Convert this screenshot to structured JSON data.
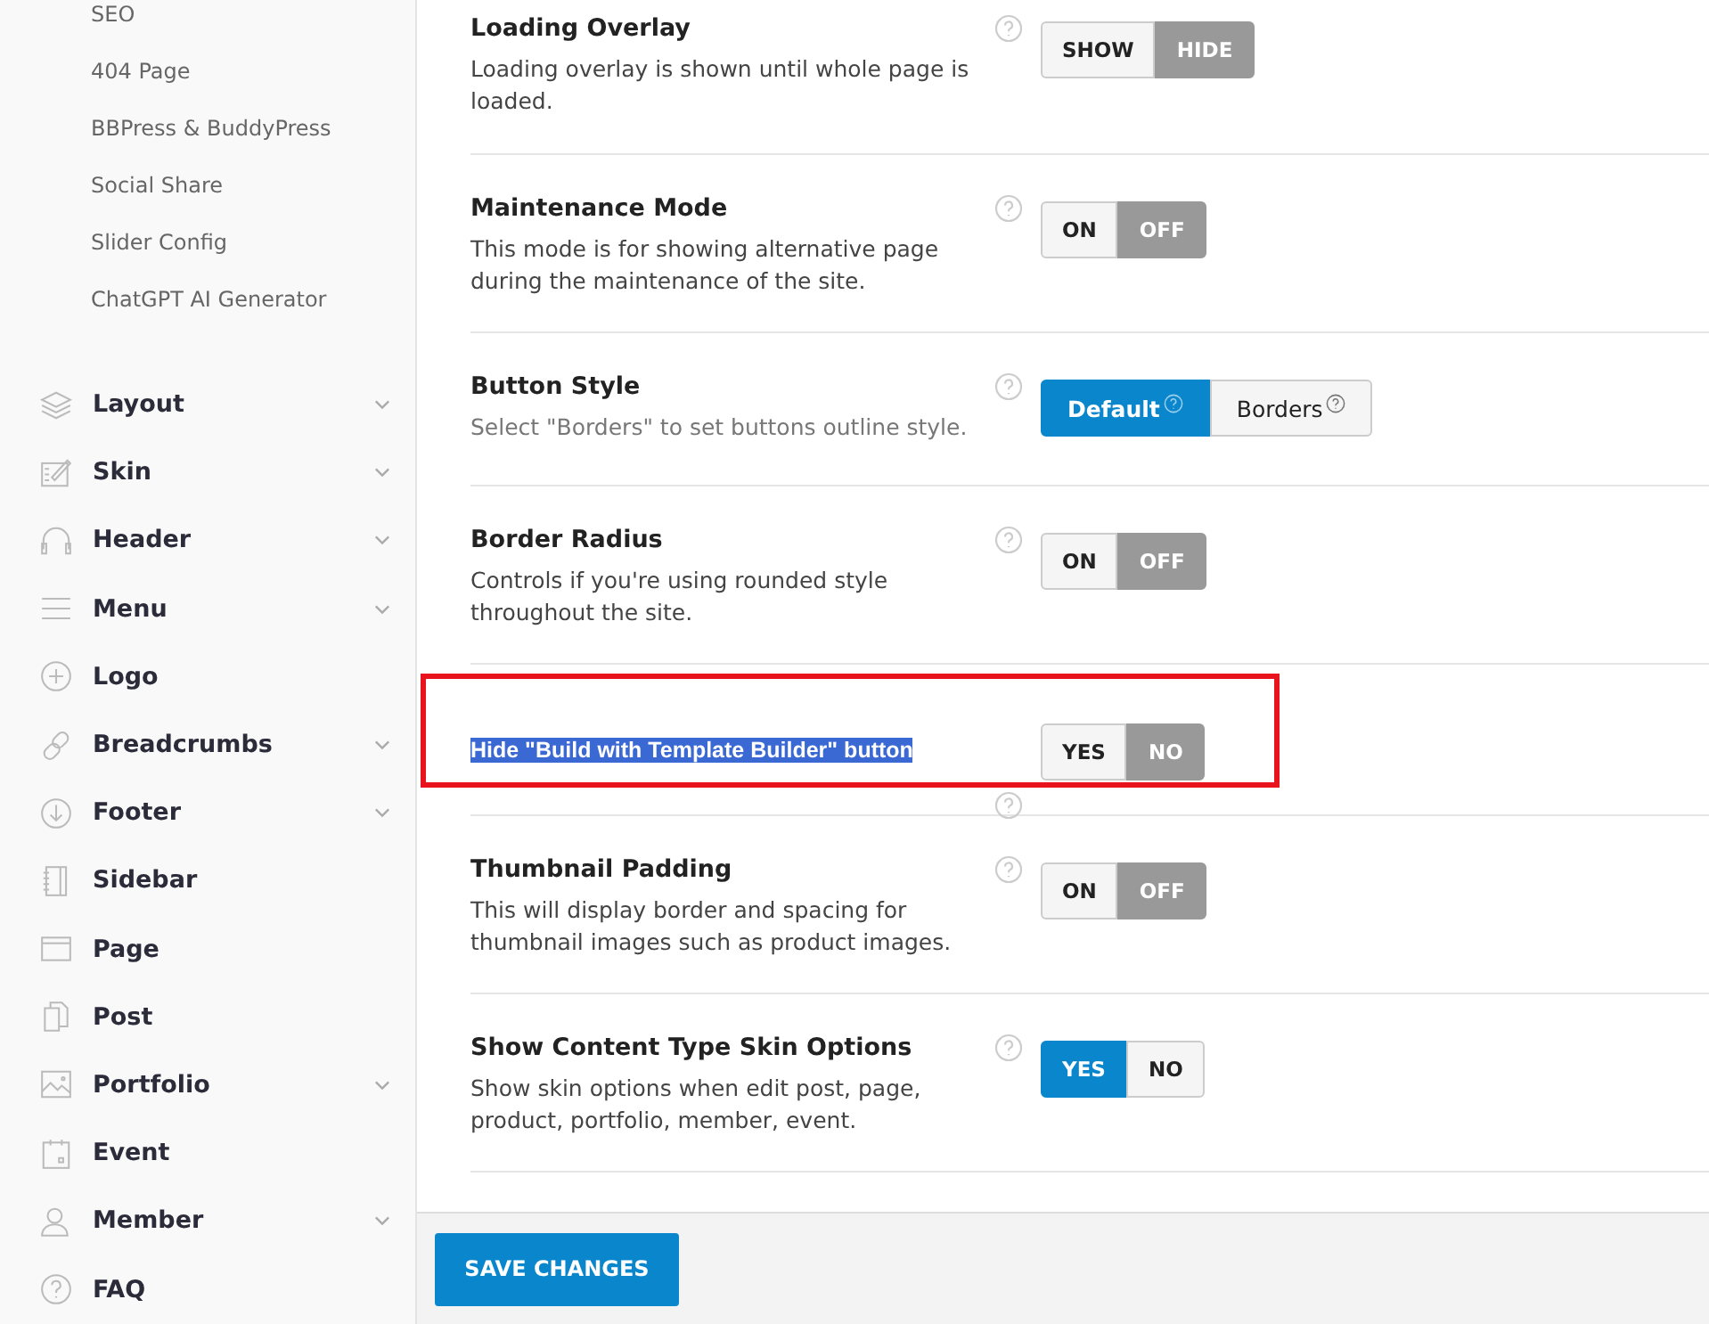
{
  "sidebar": {
    "sub_items": [
      "SEO",
      "404 Page",
      "BBPress & BuddyPress",
      "Social Share",
      "Slider Config",
      "ChatGPT AI Generator"
    ],
    "items": [
      {
        "label": "Layout",
        "expandable": true
      },
      {
        "label": "Skin",
        "expandable": true
      },
      {
        "label": "Header",
        "expandable": true
      },
      {
        "label": "Menu",
        "expandable": true
      },
      {
        "label": "Logo",
        "expandable": false
      },
      {
        "label": "Breadcrumbs",
        "expandable": true
      },
      {
        "label": "Footer",
        "expandable": true
      },
      {
        "label": "Sidebar",
        "expandable": false
      },
      {
        "label": "Page",
        "expandable": false
      },
      {
        "label": "Post",
        "expandable": false
      },
      {
        "label": "Portfolio",
        "expandable": true
      },
      {
        "label": "Event",
        "expandable": false
      },
      {
        "label": "Member",
        "expandable": true
      },
      {
        "label": "FAQ",
        "expandable": false
      }
    ]
  },
  "settings": [
    {
      "title": "Loading Overlay",
      "description": "Loading overlay is shown until whole page is loaded.",
      "options": [
        {
          "label": "SHOW",
          "selected": false
        },
        {
          "label": "HIDE",
          "selected": true,
          "color": "#999999"
        }
      ]
    },
    {
      "title": "Maintenance Mode",
      "description": "This mode is for showing alternative page during the maintenance of the site.",
      "options": [
        {
          "label": "ON",
          "selected": false
        },
        {
          "label": "OFF",
          "selected": true,
          "color": "#999999"
        }
      ]
    },
    {
      "title": "Button Style",
      "description": "Select \"Borders\" to set buttons outline style.",
      "kind": "buttons",
      "options": [
        {
          "label": "Default",
          "selected": true,
          "color": "#0a87cc"
        },
        {
          "label": "Borders",
          "selected": false
        }
      ]
    },
    {
      "title": "Border Radius",
      "description": "Controls if you're using rounded style throughout the site.",
      "options": [
        {
          "label": "ON",
          "selected": false
        },
        {
          "label": "OFF",
          "selected": true,
          "color": "#999999"
        }
      ]
    },
    {
      "title": "Hide \"Build with Template Builder\" button",
      "text_selected": true,
      "annotated": true,
      "options": [
        {
          "label": "YES",
          "selected": false
        },
        {
          "label": "NO",
          "selected": true,
          "color": "#999999"
        }
      ]
    },
    {
      "title": "Thumbnail Padding",
      "description": "This will display border and spacing for thumbnail images such as product images.",
      "options": [
        {
          "label": "ON",
          "selected": false
        },
        {
          "label": "OFF",
          "selected": true,
          "color": "#999999"
        }
      ]
    },
    {
      "title": "Show Content Type Skin Options",
      "description": "Show skin options when edit post, page, product, portfolio, member, event.",
      "options": [
        {
          "label": "YES",
          "selected": true,
          "color": "#0a87cc"
        },
        {
          "label": "NO",
          "selected": false
        }
      ]
    }
  ],
  "save_button": "SAVE CHANGES"
}
